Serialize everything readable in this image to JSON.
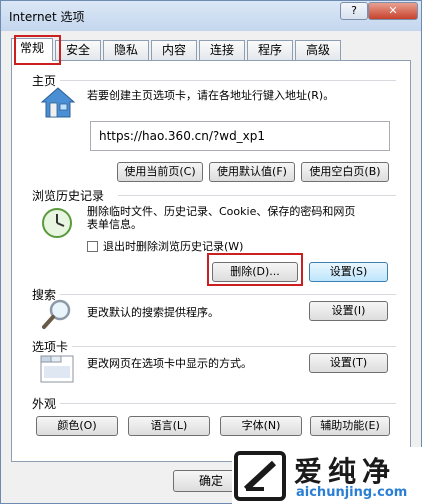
{
  "window": {
    "title": "Internet 选项",
    "help_label": "?",
    "close_label": "✕"
  },
  "tabs": [
    "常规",
    "安全",
    "隐私",
    "内容",
    "连接",
    "程序",
    "高级"
  ],
  "home": {
    "title": "主页",
    "desc": "若要创建主页选项卡，请在各地址行键入地址(R)。",
    "url": "https://hao.360.cn/?wd_xp1",
    "btn_current": "使用当前页(C)",
    "btn_default": "使用默认值(F)",
    "btn_blank": "使用空白页(B)"
  },
  "history": {
    "title": "浏览历史记录",
    "desc_line1": "删除临时文件、历史记录、Cookie、保存的密码和网页",
    "desc_line2": "表单信息。",
    "checkbox_label": "退出时删除浏览历史记录(W)",
    "btn_delete": "删除(D)...",
    "btn_settings": "设置(S)"
  },
  "search": {
    "title": "搜索",
    "desc": "更改默认的搜索提供程序。",
    "btn_settings": "设置(I)"
  },
  "tabsgroup": {
    "title": "选项卡",
    "desc": "更改网页在选项卡中显示的方式。",
    "btn_settings": "设置(T)"
  },
  "appearance": {
    "title": "外观",
    "btn_colors": "颜色(O)",
    "btn_languages": "语言(L)",
    "btn_fonts": "字体(N)",
    "btn_accessibility": "辅助功能(E)"
  },
  "footer": {
    "btn_ok": "确定"
  },
  "watermark": {
    "brand": "爱纯净",
    "url": "aichunjing.com"
  }
}
